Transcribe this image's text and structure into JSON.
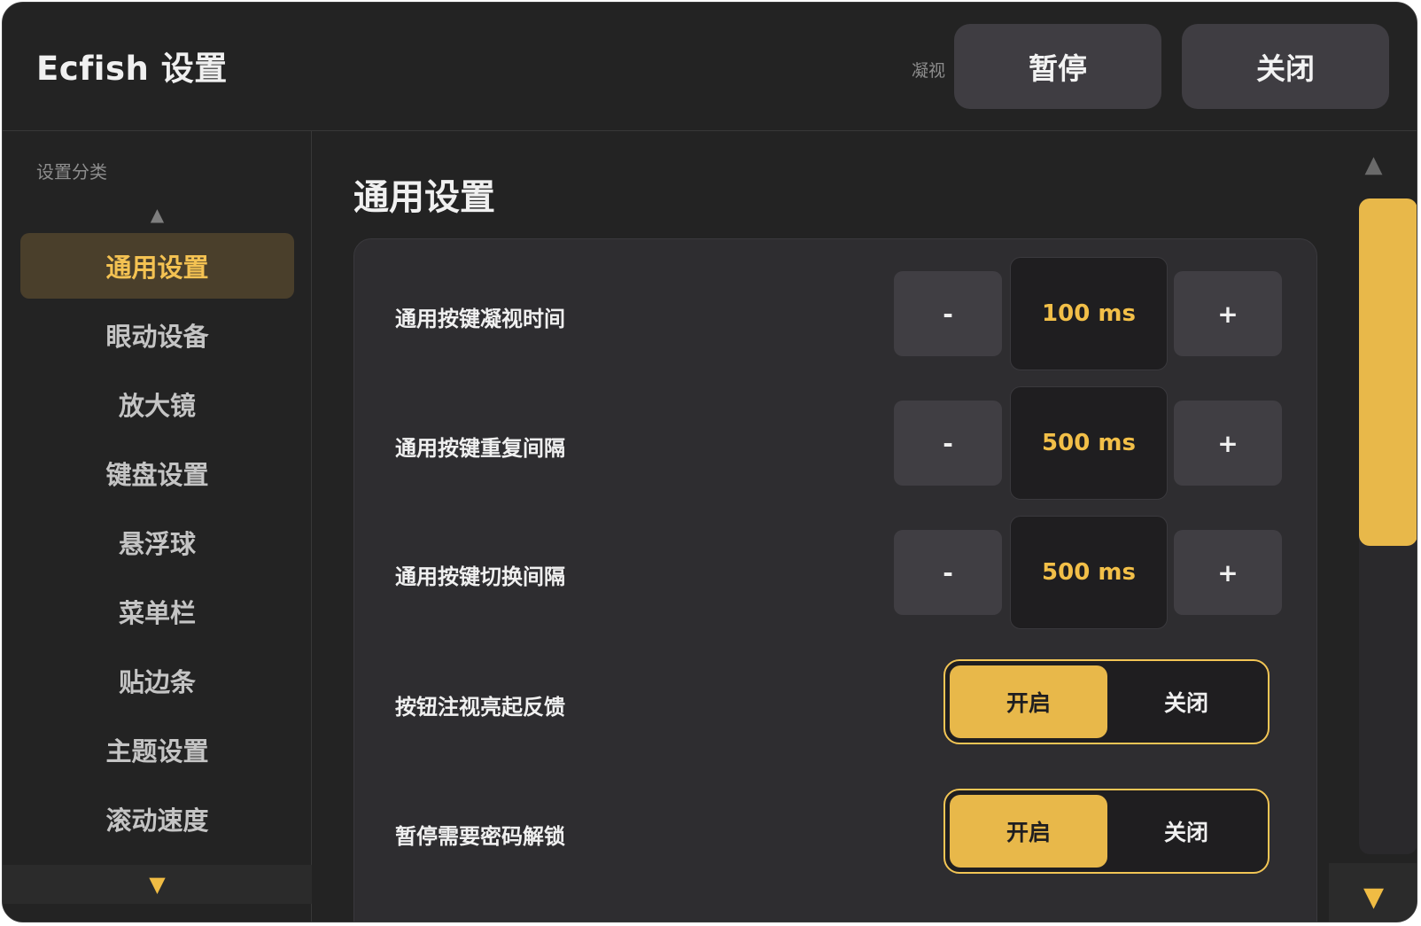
{
  "header": {
    "title": "Ecfish 设置",
    "hint": "凝视",
    "pause_label": "暂停",
    "close_label": "关闭"
  },
  "sidebar": {
    "caption": "设置分类",
    "up_arrow": "▲",
    "down_arrow": "▼",
    "items": [
      {
        "label": "通用设置",
        "active": true
      },
      {
        "label": "眼动设备"
      },
      {
        "label": "放大镜"
      },
      {
        "label": "键盘设置"
      },
      {
        "label": "悬浮球"
      },
      {
        "label": "菜单栏"
      },
      {
        "label": "贴边条"
      },
      {
        "label": "主题设置"
      },
      {
        "label": "滚动速度"
      }
    ]
  },
  "main": {
    "title": "通用设置",
    "steppers": [
      {
        "label": "通用按键凝视时间",
        "value": "100 ms",
        "minus": "-",
        "plus": "+"
      },
      {
        "label": "通用按键重复间隔",
        "value": "500 ms",
        "minus": "-",
        "plus": "+"
      },
      {
        "label": "通用按键切换间隔",
        "value": "500 ms",
        "minus": "-",
        "plus": "+"
      }
    ],
    "toggles": [
      {
        "label": "按钮注视亮起反馈",
        "on_label": "开启",
        "off_label": "关闭",
        "selected": "on"
      },
      {
        "label": "暂停需要密码解锁",
        "on_label": "开启",
        "off_label": "关闭",
        "selected": "on"
      }
    ]
  },
  "scrollbar": {
    "up_arrow": "▲",
    "down_arrow": "▼",
    "position_fraction": 0.0,
    "thumb_fraction": 0.53
  },
  "colors": {
    "accent": "#e8b84a",
    "background": "#232323",
    "panel": "#2e2d30"
  }
}
